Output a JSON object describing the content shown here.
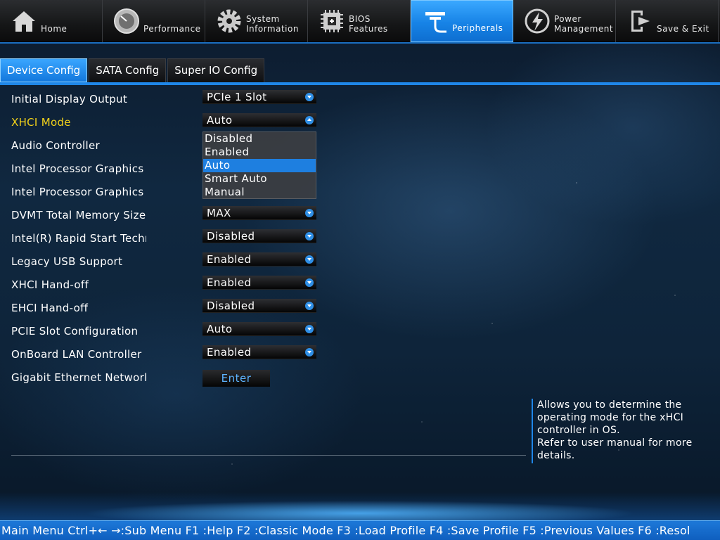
{
  "nav": {
    "tabs": [
      {
        "label": "Home",
        "icon": "home-icon"
      },
      {
        "label": "Performance",
        "icon": "gauge-icon"
      },
      {
        "label": "System\nInformation",
        "icon": "gear-icon"
      },
      {
        "label": "BIOS\nFeatures",
        "icon": "chip-icon"
      },
      {
        "label": "Peripherals",
        "icon": "plug-icon"
      },
      {
        "label": "Power\nManagement",
        "icon": "power-icon"
      },
      {
        "label": "Save & Exit",
        "icon": "exit-icon"
      }
    ],
    "active_index": 4
  },
  "subtabs": [
    {
      "label": "Device Config"
    },
    {
      "label": "SATA Config"
    },
    {
      "label": "Super IO Config"
    }
  ],
  "settings": [
    {
      "label": "Initial Display Output",
      "value": "PCIe 1 Slot"
    },
    {
      "label": "XHCI Mode",
      "value": "Auto"
    },
    {
      "label": "Audio Controller",
      "value": ""
    },
    {
      "label": "Intel Processor Graphics",
      "value": ""
    },
    {
      "label": "Intel Processor Graphics M",
      "value": ""
    },
    {
      "label": "DVMT Total Memory Size",
      "value": "MAX"
    },
    {
      "label": "Intel(R) Rapid Start Techn",
      "value": "Disabled"
    },
    {
      "label": "Legacy USB Support",
      "value": "Enabled"
    },
    {
      "label": "XHCI Hand-off",
      "value": "Enabled"
    },
    {
      "label": "EHCI Hand-off",
      "value": "Disabled"
    },
    {
      "label": "PCIE Slot Configuration",
      "value": "Auto"
    },
    {
      "label": "OnBoard LAN Controller",
      "value": "Enabled"
    },
    {
      "label": "Gigabit Ethernet Network",
      "value": "Enter"
    }
  ],
  "dropdown": {
    "options": [
      "Disabled",
      "Enabled",
      "Auto",
      "Smart Auto",
      "Manual"
    ],
    "highlighted": "Auto"
  },
  "help": {
    "text": "Allows you to determine the operating mode for the xHCI controller in OS.\nRefer to user manual for more details."
  },
  "statusbar": {
    "text": "Main Menu Ctrl+← →:Sub Menu F1 :Help F2 :Classic Mode F3 :Load Profile F4 :Save Profile F5 :Previous Values F6 :Resol"
  },
  "colors": {
    "accent": "#1f86e8",
    "selected_label": "#f2d21a",
    "enter_text": "#5db4ff"
  }
}
